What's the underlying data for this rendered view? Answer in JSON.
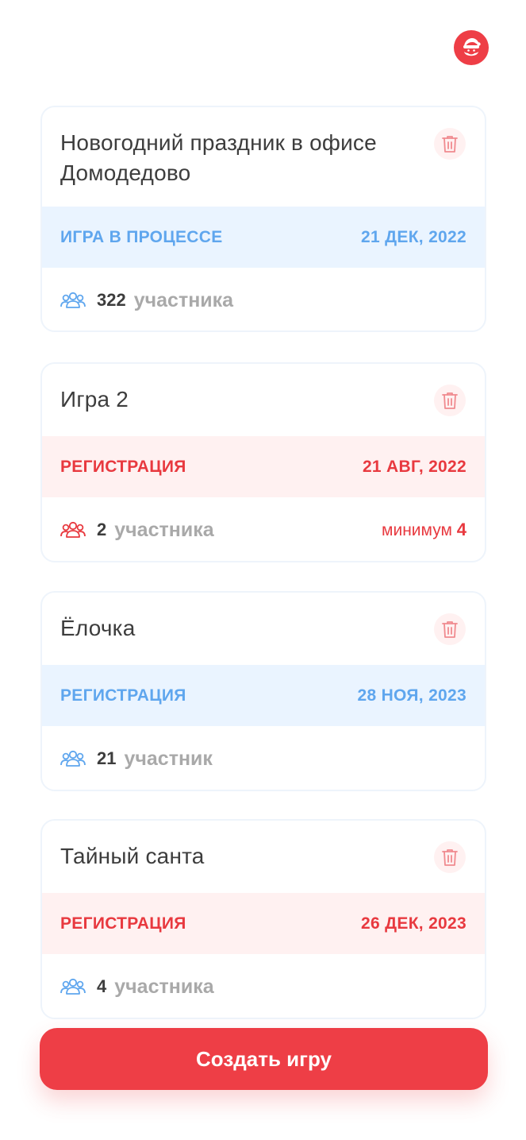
{
  "header": {
    "avatar_icon": "santa-icon",
    "accent_color": "#ee3e46"
  },
  "games": [
    {
      "title": "Новогодний праздник в офисе Домодедово",
      "status": "ИГРА В ПРОЦЕССЕ",
      "date": "21 ДЕК, 2022",
      "status_color": "#5fa6ee",
      "participants_count": "322",
      "participants_label": "участника",
      "minimum_text": "",
      "minimum_value": ""
    },
    {
      "title": "Игра 2",
      "status": "РЕГИСТРАЦИЯ",
      "date": "21 АВГ, 2022",
      "status_color": "#e8393f",
      "participants_count": "2",
      "participants_label": "участника",
      "minimum_text": "минимум",
      "minimum_value": "4"
    },
    {
      "title": "Ёлочка",
      "status": "РЕГИСТРАЦИЯ",
      "date": "28 НОЯ, 2023",
      "status_color": "#5fa6ee",
      "participants_count": "21",
      "participants_label": "участник",
      "minimum_text": "",
      "minimum_value": ""
    },
    {
      "title": "Тайный санта",
      "status": "РЕГИСТРАЦИЯ",
      "date": "26 ДЕК, 2023",
      "status_color": "#e8393f",
      "participants_count": "4",
      "participants_label": "участника",
      "minimum_text": "",
      "minimum_value": ""
    }
  ],
  "create_button": {
    "label": "Создать игру"
  }
}
